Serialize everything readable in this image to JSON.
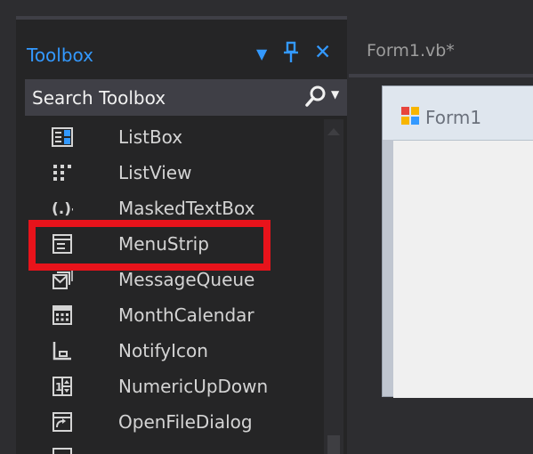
{
  "toolbox": {
    "title": "Toolbox",
    "dropdown_glyph": "▼",
    "pin_glyph": "📌",
    "close_glyph": "✕",
    "search": {
      "placeholder": "Search Toolbox",
      "icon": "search-icon"
    },
    "items": [
      {
        "label": "ListBox",
        "icon": "listbox-icon"
      },
      {
        "label": "ListView",
        "icon": "listview-icon"
      },
      {
        "label": "MaskedTextBox",
        "icon": "maskedtextbox-icon"
      },
      {
        "label": "MenuStrip",
        "icon": "menustrip-icon",
        "highlighted": true
      },
      {
        "label": "MessageQueue",
        "icon": "messagequeue-icon"
      },
      {
        "label": "MonthCalendar",
        "icon": "monthcalendar-icon"
      },
      {
        "label": "NotifyIcon",
        "icon": "notifyicon-icon"
      },
      {
        "label": "NumericUpDown",
        "icon": "numericupdown-icon"
      },
      {
        "label": "OpenFileDialog",
        "icon": "openfiledialog-icon"
      }
    ]
  },
  "editor": {
    "doc_tab": "Form1.vb*",
    "form_title": "Form1"
  },
  "colors": {
    "accent": "#3399ff",
    "highlight_border": "#e8131b",
    "panel_bg": "#252526",
    "chrome_bg": "#2d2d30"
  }
}
